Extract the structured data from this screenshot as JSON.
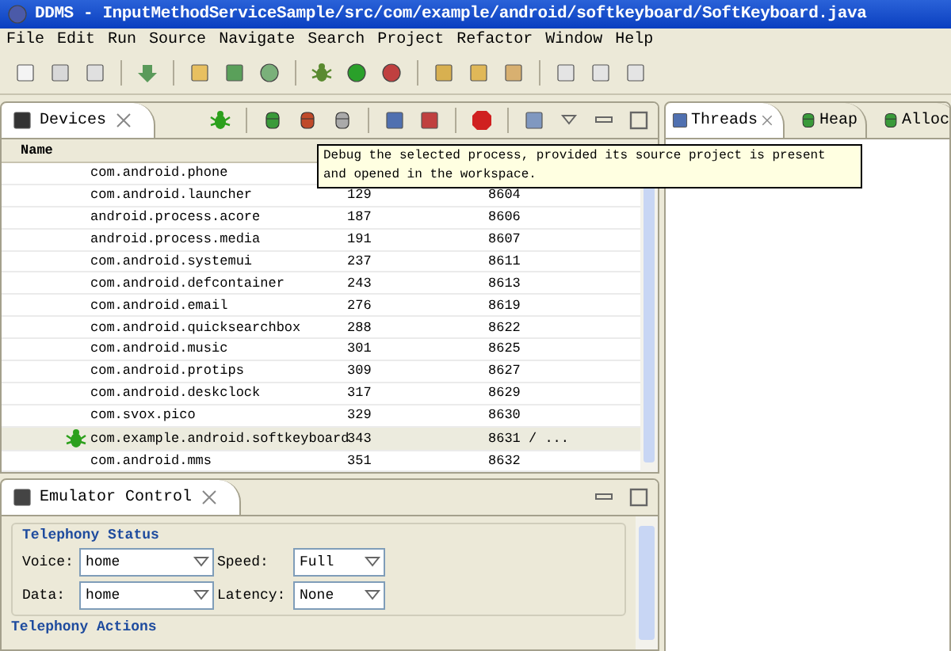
{
  "window": {
    "title": "DDMS - InputMethodServiceSample/src/com/example/android/softkeyboard/SoftKeyboard.java"
  },
  "menu": [
    "File",
    "Edit",
    "Run",
    "Source",
    "Navigate",
    "Search",
    "Project",
    "Refactor",
    "Window",
    "Help"
  ],
  "devices": {
    "tab": "Devices",
    "columns": [
      "Name"
    ],
    "rows": [
      {
        "name": "com.android.phone",
        "selected": false,
        "debugging": false
      },
      {
        "name": "com.android.launcher",
        "pid": "129",
        "port": "8604",
        "selected": false,
        "debugging": false
      },
      {
        "name": "android.process.acore",
        "pid": "187",
        "port": "8606",
        "selected": false,
        "debugging": false
      },
      {
        "name": "android.process.media",
        "pid": "191",
        "port": "8607",
        "selected": false,
        "debugging": false
      },
      {
        "name": "com.android.systemui",
        "pid": "237",
        "port": "8611",
        "selected": false,
        "debugging": false
      },
      {
        "name": "com.android.defcontainer",
        "pid": "243",
        "port": "8613",
        "selected": false,
        "debugging": false
      },
      {
        "name": "com.android.email",
        "pid": "276",
        "port": "8619",
        "selected": false,
        "debugging": false
      },
      {
        "name": "com.android.quicksearchbox",
        "pid": "288",
        "port": "8622",
        "selected": false,
        "debugging": false
      },
      {
        "name": "com.android.music",
        "pid": "301",
        "port": "8625",
        "selected": false,
        "debugging": false
      },
      {
        "name": "com.android.protips",
        "pid": "309",
        "port": "8627",
        "selected": false,
        "debugging": false
      },
      {
        "name": "com.android.deskclock",
        "pid": "317",
        "port": "8629",
        "selected": false,
        "debugging": false
      },
      {
        "name": "com.svox.pico",
        "pid": "329",
        "port": "8630",
        "selected": false,
        "debugging": false
      },
      {
        "name": "com.example.android.softkeyboard",
        "pid": "343",
        "port": "8631 / ...",
        "selected": true,
        "debugging": true
      },
      {
        "name": "com.android.mms",
        "pid": "351",
        "port": "8632",
        "selected": false,
        "debugging": false
      }
    ],
    "tooltip": "Debug the selected process, provided its source project is present and opened in the workspace."
  },
  "right_tabs": [
    {
      "label": "Threads",
      "selected": true
    },
    {
      "label": "Heap",
      "selected": false
    },
    {
      "label": "Alloc",
      "selected": false
    }
  ],
  "emulator": {
    "tab": "Emulator Control",
    "section": "Telephony Status",
    "fields": [
      {
        "label": "Voice:",
        "value": "home",
        "label2": "Speed:",
        "value2": "Full"
      },
      {
        "label": "Data:",
        "value": "home",
        "label2": "Latency:",
        "value2": "None"
      }
    ],
    "next_section": "Telephony Actions"
  }
}
